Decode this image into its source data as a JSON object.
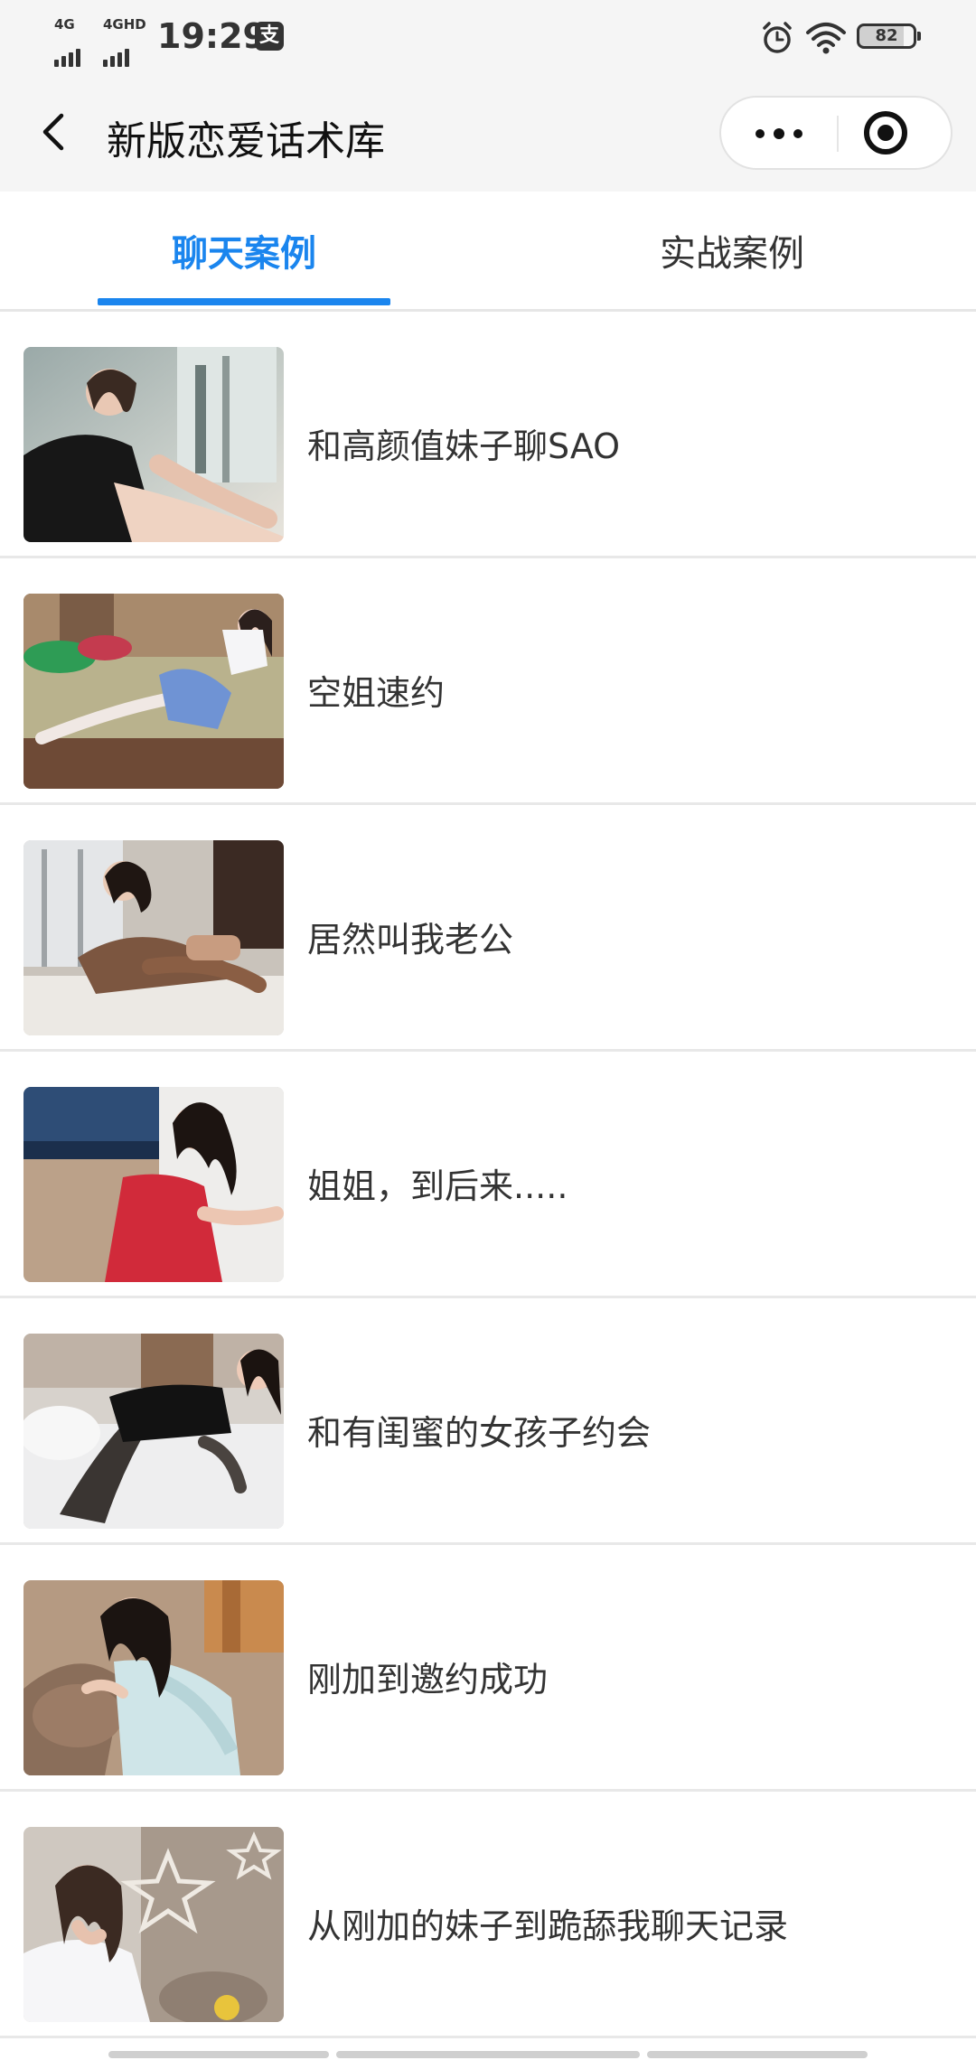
{
  "status_bar": {
    "signal1_label": "4G",
    "signal2_label": "4GHD",
    "time": "19:29",
    "pay_icon": "alipay-icon",
    "battery_level": "82"
  },
  "nav": {
    "title": "新版恋爱话术库",
    "back_icon": "chevron-left-icon",
    "more_icon": "more-dots-icon",
    "close_icon": "target-circle-icon"
  },
  "tabs": [
    {
      "label": "聊天案例",
      "active": true
    },
    {
      "label": "实战案例",
      "active": false
    }
  ],
  "accent_color": "#1a85ee",
  "list": [
    {
      "title": "和高颜值妹子聊SAO"
    },
    {
      "title": "空姐速约"
    },
    {
      "title": "居然叫我老公"
    },
    {
      "title": "姐姐，到后来....."
    },
    {
      "title": "和有闺蜜的女孩子约会"
    },
    {
      "title": "刚加到邀约成功"
    },
    {
      "title": "从刚加的妹子到跪舔我聊天记录"
    }
  ]
}
